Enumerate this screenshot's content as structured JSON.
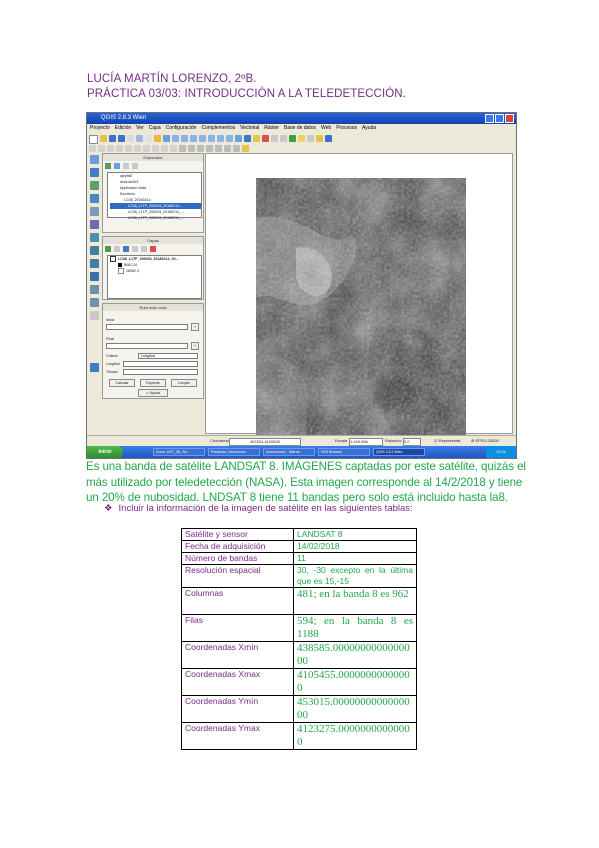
{
  "header": {
    "author": "LUCÍA MARTÍN LORENZO, 2ºB.",
    "practice": "PRÁCTICA 03/03: INTRODUCCIÓN A LA TELEDETECCIÓN."
  },
  "qgis": {
    "window_title": "QGIS 2.8.3 Wien",
    "menu": [
      "Proyecto",
      "Edición",
      "Ver",
      "Capa",
      "Configuración",
      "Complementos",
      "Vectorial",
      "Ráster",
      "Base de datos",
      "Web",
      "Procesos",
      "Ayuda"
    ],
    "browser_panel_title": "Explorador",
    "browser_items": [
      "ajeyfal2",
      "Android3d3",
      "Application Data",
      "Escritorio",
      "LC08_20180214",
      "LC08_L1TP_200034_20180214...",
      "LC08_L1TP_200034_20180214_...",
      "LC08_L1TP_200034_20180214_..."
    ],
    "layers_panel_title": "Capas",
    "layer_name": "LC08_L1TP_200034_20180214_20...",
    "layer_legend": [
      "8081,34",
      "18982,3"
    ],
    "route_panel_title": "Ruta más corta",
    "route_labels": [
      "Inicio",
      "Final",
      "Criterio",
      "Longitud",
      "Tiempo"
    ],
    "criterion_value": "Longitud",
    "route_buttons": [
      "Calcular",
      "Exportar",
      "Limpiar"
    ],
    "help_button": "Ayuda",
    "status_coord_label": "Coordenada:",
    "status_coord_value": "467634,4120540",
    "status_scale_label": "Escala",
    "status_scale_value": "1:445.066",
    "status_rotation_label": "Rotación:",
    "status_rotation_value": "0,0",
    "status_render_label": "Representar",
    "status_epsg": "EPSG:32630",
    "taskbar_start": "Inicio",
    "taskbar_items": [
      "Curso 1007_08_04/...",
      "Prácticas | Introducció...",
      "Documento1 - Micros...",
      "DSS Browser",
      "QGIS 2.8.3 Wien"
    ],
    "tray_time": "13:02"
  },
  "paragraph": "Es una banda de satélite LANDSAT 8. IMÁGENES captadas por este satélite, quizás el más utilizado por teledetección (NASA). Esta imagen corresponde al 14/2/2018 y tiene un 20% de nubosidad. LNDSAT 8 tiene 11 bandas pero solo está incluido hasta la8.",
  "bullet": "Incluir la información de la imagen de satélite en las siguientes tablas:",
  "table": [
    {
      "key": "Satélite y sensor",
      "value": "LANDSAT 8"
    },
    {
      "key": "Fecha de adquisición",
      "value": "14/02/2018"
    },
    {
      "key": "Número de bandas",
      "value": "11"
    },
    {
      "key": "Resolución espacial",
      "value": "30, -30 excepto en la última que es 15,-15"
    },
    {
      "key": "Columnas",
      "value": "481; en la banda 8 es 962"
    },
    {
      "key": "Filas",
      "value": "594; en la banda 8 es 1188"
    },
    {
      "key": "Coordenadas Xmín",
      "value": "438585.0000000000000000"
    },
    {
      "key": "Coordenadas Xmax",
      "value": "4105455.00000000000000"
    },
    {
      "key": "Coordenadas Ymín",
      "value": "453015.0000000000000000"
    },
    {
      "key": "Coordenadas Ymax",
      "value": "4123275.00000000000000"
    }
  ]
}
